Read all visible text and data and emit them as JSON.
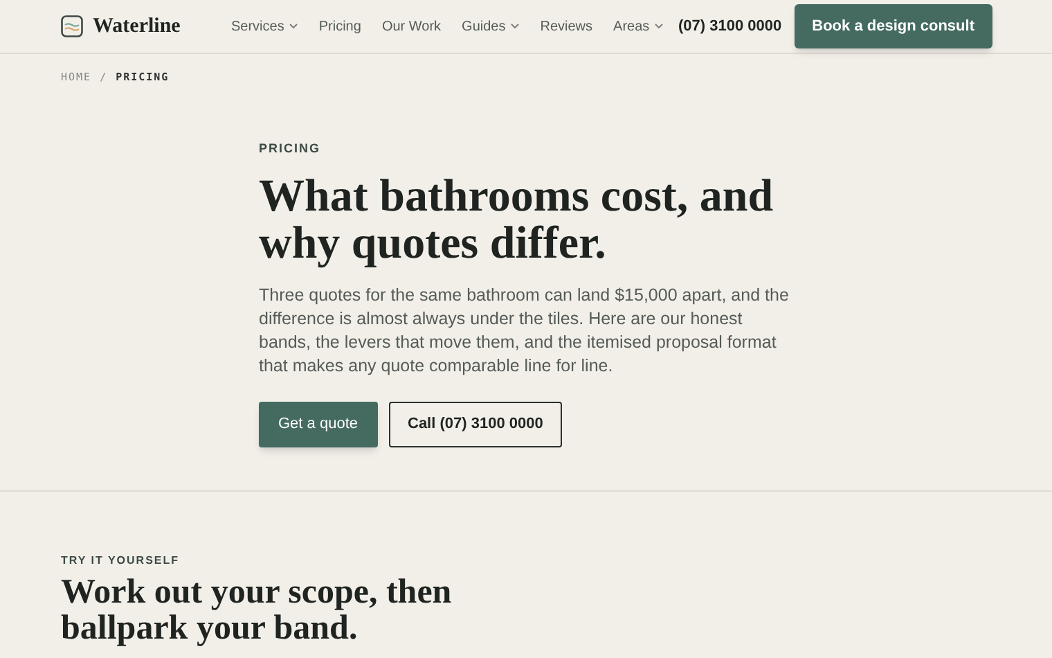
{
  "header": {
    "brand": "Waterline",
    "nav": [
      {
        "label": "Services",
        "dropdown": true
      },
      {
        "label": "Pricing",
        "dropdown": false
      },
      {
        "label": "Our Work",
        "dropdown": false
      },
      {
        "label": "Guides",
        "dropdown": true
      },
      {
        "label": "Reviews",
        "dropdown": false
      },
      {
        "label": "Areas",
        "dropdown": true
      }
    ],
    "phone": "(07) 3100 0000",
    "cta": "Book a design consult"
  },
  "breadcrumb": [
    "HOME",
    "PRICING"
  ],
  "breadcrumb_separator": "/",
  "hero": {
    "eyebrow": "PRICING",
    "title": "What bathrooms cost, and why quotes differ.",
    "lead": "Three quotes for the same bathroom can land $15,000 apart, and the difference is almost always under the tiles. Here are our honest bands, the levers that move them, and the itemised proposal format that makes any quote comparable line for line.",
    "buttons": [
      {
        "label": "Get a quote",
        "kind": "primary"
      },
      {
        "label": "Call (07) 3100 0000",
        "kind": "outline"
      }
    ]
  },
  "section": {
    "eyebrow": "TRY IT YOURSELF",
    "title": "Work out your scope, then ballpark your band."
  }
}
